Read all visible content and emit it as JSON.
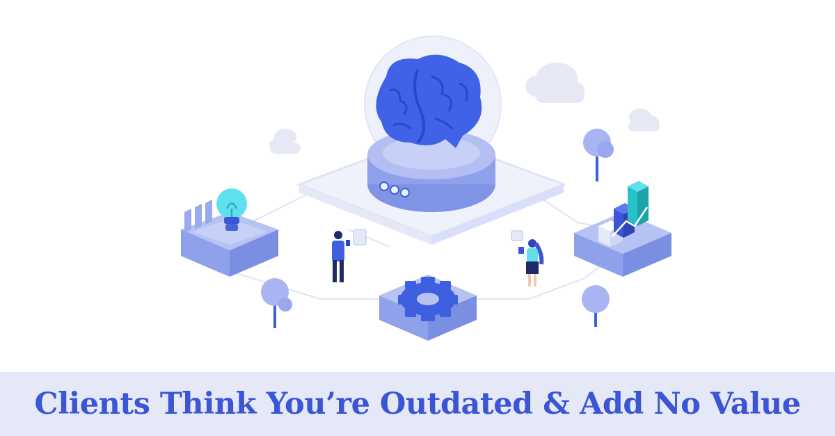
{
  "headline": "Clients Think You’re Outdated & Add No Value",
  "colors": {
    "headline_text": "#3b55d4",
    "banner_background": "#e4e8f7",
    "brain": "#3f62e6",
    "platform_light": "#dfe4f7",
    "platform_side": "#8fa1ea",
    "platform_top": "#b6c2f2",
    "gear": "#3d5fe0",
    "bulb": "#5fe0ee",
    "chart_teal": "#27c1c9",
    "chart_blue": "#3b55d4",
    "tree": "#a9b4f2",
    "cloud": "#e6e9f5"
  },
  "icons": [
    "brain-icon",
    "lightbulb-icon",
    "gear-icon",
    "bar-chart-icon",
    "tree-icon",
    "cloud-icon",
    "person-man-icon",
    "person-woman-icon"
  ]
}
